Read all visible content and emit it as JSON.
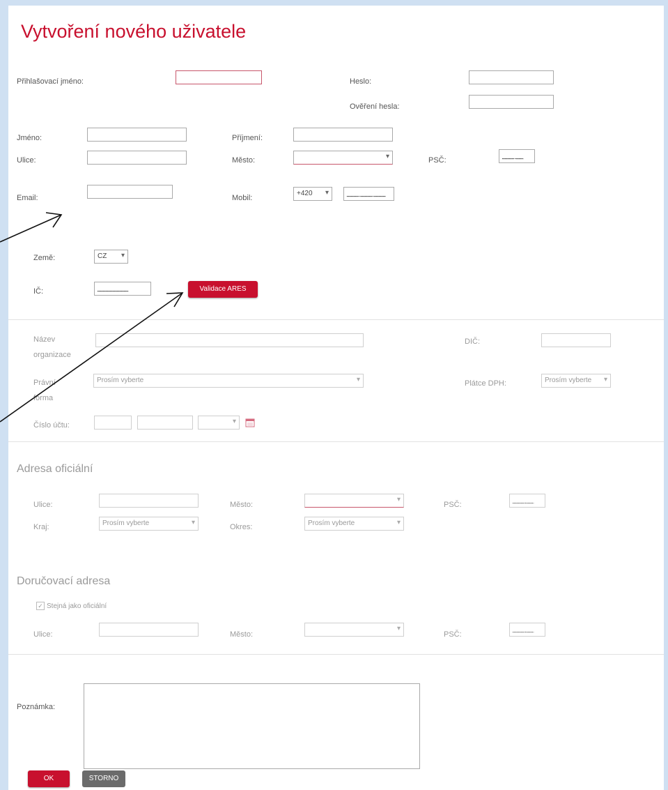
{
  "title": "Vytvoření nového uživatele",
  "login": {
    "username_label": "Přihlašovací jméno:",
    "password_label": "Heslo:",
    "password_confirm_label": "Ověření hesla:"
  },
  "personal": {
    "first_name_label": "Jméno:",
    "last_name_label": "Příjmení:",
    "street_label": "Ulice:",
    "city_label": "Město:",
    "zip_label": "PSČ:",
    "zip_value": "___ __",
    "email_label": "Email:",
    "mobile_label": "Mobil:",
    "mobile_prefix": "+420",
    "mobile_value": "___ ___ ___"
  },
  "company": {
    "country_label": "Země:",
    "country_value": "CZ",
    "ico_label": "IČ:",
    "ico_value": "________",
    "validate_button": "Validace ARES",
    "org_name_label": "Název organizace",
    "dic_label": "DIČ:",
    "legal_form_label": "Právní forma",
    "legal_form_value": "Prosím vyberte",
    "vat_payer_label": "Plátce DPH:",
    "vat_payer_value": "Prosím vyberte",
    "account_label": "Číslo účtu:"
  },
  "official_address": {
    "heading": "Adresa oficiální",
    "street_label": "Ulice:",
    "city_label": "Město:",
    "zip_label": "PSČ:",
    "zip_value": "___ __",
    "region_label": "Kraj:",
    "region_value": "Prosím vyberte",
    "district_label": "Okres:",
    "district_value": "Prosím vyberte"
  },
  "delivery_address": {
    "heading": "Doručovací adresa",
    "same_as_official_label": "Stejná jako oficiální",
    "street_label": "Ulice:",
    "city_label": "Město:",
    "zip_label": "PSČ:",
    "zip_value": "___ __"
  },
  "note": {
    "label": "Poznámka:"
  },
  "actions": {
    "ok": "OK",
    "cancel": "STORNO"
  },
  "colors": {
    "accent": "#c8102e",
    "background": "#cfe0f2"
  }
}
